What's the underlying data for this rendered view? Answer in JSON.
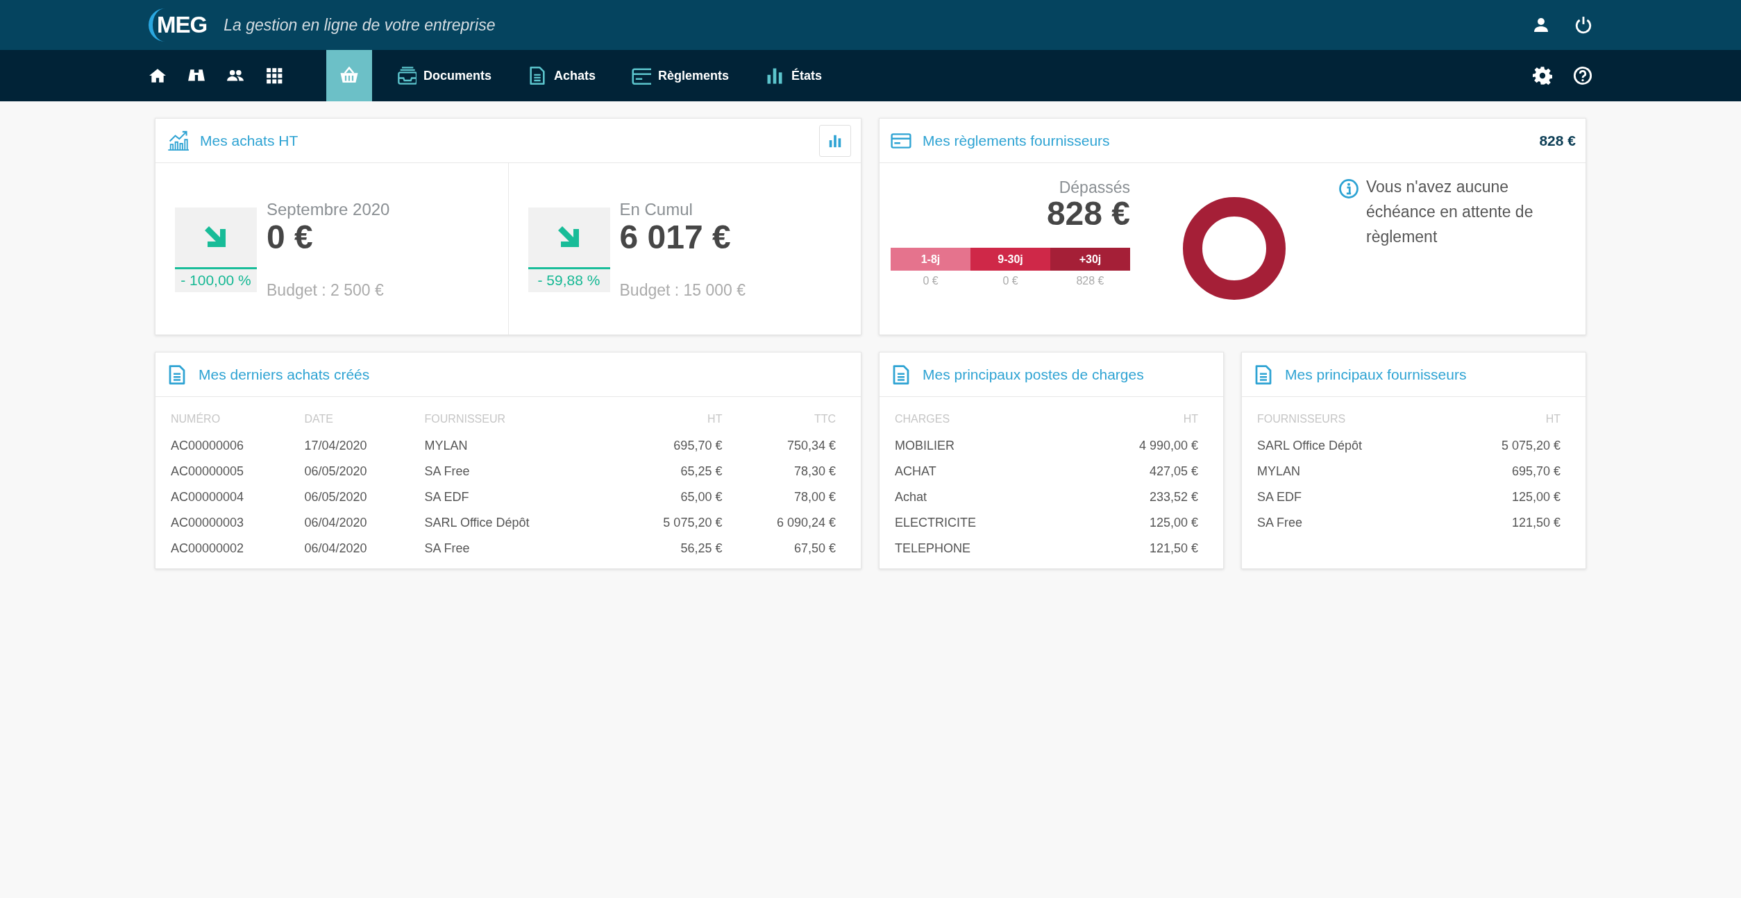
{
  "header": {
    "logo": "MEG",
    "tagline": "La gestion en ligne de votre entreprise"
  },
  "nav": {
    "tabs": [
      {
        "selected": true
      },
      {
        "label": "Documents",
        "selected": false
      },
      {
        "label": "Achats",
        "selected": false
      },
      {
        "label": "Règlements",
        "selected": false
      },
      {
        "label": "États",
        "selected": false
      }
    ]
  },
  "achats_ht": {
    "title": "Mes achats HT",
    "stats": [
      {
        "period": "Septembre 2020",
        "amount": "0 €",
        "change": "- 100,00 %",
        "budget": "Budget : 2 500 €"
      },
      {
        "period": "En Cumul",
        "amount": "6 017 €",
        "change": "- 59,88 %",
        "budget": "Budget : 15 000 €"
      }
    ]
  },
  "reglements": {
    "title": "Mes règlements fournisseurs",
    "total": "828 €",
    "overdue_label": "Dépassés",
    "overdue_amount": "828 €",
    "buckets": [
      {
        "label": "1-8j",
        "amount": "0 €",
        "color": "#e5738d"
      },
      {
        "label": "9-30j",
        "amount": "0 €",
        "color": "#cf2848"
      },
      {
        "label": "+30j",
        "amount": "828 €",
        "color": "#a51f37"
      }
    ],
    "message": "Vous n'avez aucune échéance en attente de règlement"
  },
  "derniers_achats": {
    "title": "Mes derniers achats créés",
    "columns": [
      {
        "label": "NUMÉRO",
        "kind": "text"
      },
      {
        "label": "DATE",
        "kind": "text"
      },
      {
        "label": "FOURNISSEUR",
        "kind": "text"
      },
      {
        "label": "HT",
        "kind": "amount"
      },
      {
        "label": "TTC",
        "kind": "amount"
      }
    ],
    "rows": [
      [
        "AC00000006",
        "17/04/2020",
        "MYLAN",
        "695,70 €",
        "750,34 €"
      ],
      [
        "AC00000005",
        "06/05/2020",
        "SA Free",
        "65,25 €",
        "78,30 €"
      ],
      [
        "AC00000004",
        "06/05/2020",
        "SA EDF",
        "65,00 €",
        "78,00 €"
      ],
      [
        "AC00000003",
        "06/04/2020",
        "SARL Office Dépôt",
        "5 075,20 €",
        "6 090,24 €"
      ],
      [
        "AC00000002",
        "06/04/2020",
        "SA Free",
        "56,25 €",
        "67,50 €"
      ]
    ]
  },
  "postes_charges": {
    "title": "Mes principaux postes de charges",
    "columns": [
      {
        "label": "CHARGES",
        "kind": "text"
      },
      {
        "label": "HT",
        "kind": "amount"
      }
    ],
    "rows": [
      [
        "MOBILIER",
        "4 990,00 €"
      ],
      [
        "ACHAT",
        "427,05 €"
      ],
      [
        "Achat",
        "233,52 €"
      ],
      [
        "ELECTRICITE",
        "125,00 €"
      ],
      [
        "TELEPHONE",
        "121,50 €"
      ]
    ]
  },
  "fournisseurs": {
    "title": "Mes principaux fournisseurs",
    "columns": [
      {
        "label": "FOURNISSEURS",
        "kind": "text"
      },
      {
        "label": "HT",
        "kind": "amount"
      }
    ],
    "rows": [
      [
        "SARL Office Dépôt",
        "5 075,20 €"
      ],
      [
        "MYLAN",
        "695,70 €"
      ],
      [
        "SA EDF",
        "125,00 €"
      ],
      [
        "SA Free",
        "121,50 €"
      ]
    ]
  }
}
